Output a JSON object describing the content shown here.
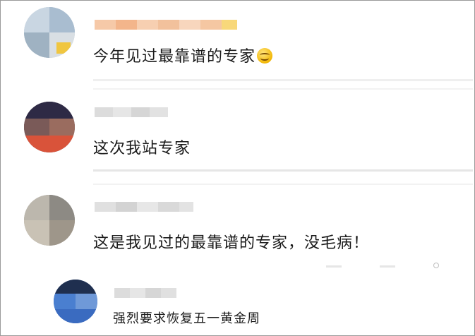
{
  "comments": [
    {
      "text": "今年见过最靠谱的专家",
      "emoji": "smile-emoji"
    },
    {
      "text": "这次我站专家"
    },
    {
      "text": "这是我见过的最靠谱的专家，没毛病！"
    }
  ],
  "reply": {
    "text": "强烈要求恢复五一黄金周"
  },
  "colors": {
    "background": "#ffffff",
    "text": "#1a1a1a",
    "divider": "#efefef"
  }
}
